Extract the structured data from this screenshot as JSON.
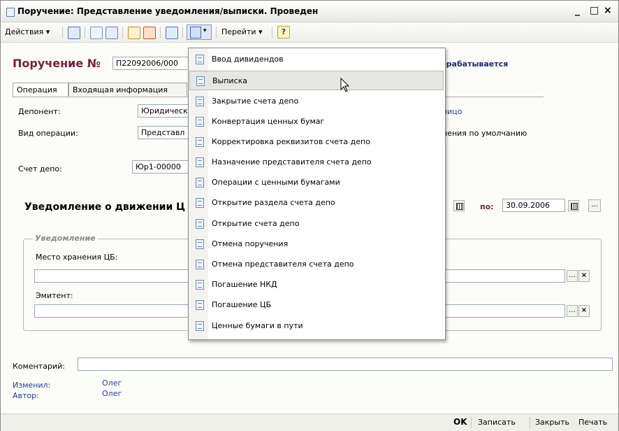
{
  "window": {
    "title": "Поручение: Представление уведомления/выписки. Проведен",
    "minimize": "_",
    "maximize": "□",
    "close": "×"
  },
  "toolbar": {
    "actions_label": "Действия ▾",
    "goto_label": "Перейти ▾",
    "help_label": "?"
  },
  "header": {
    "title": "Поручение №",
    "number": "П22092006/000",
    "status": "брабатывается"
  },
  "tabs": [
    {
      "label": "Операция"
    },
    {
      "label": "Входящая информация"
    }
  ],
  "form": {
    "deponent_label": "Депонент:",
    "deponent_value": "Юридическ",
    "optype_label": "Вид операции:",
    "optype_value": "Представл",
    "account_label": "Счет депо:",
    "account_value": "Юр1-00000",
    "right_link": "лицо",
    "right_text": "нения по умолчанию",
    "notice_title": "Уведомление о движении Ц",
    "to_label": "по:",
    "to_date": "30.09.2006",
    "group_label": "Уведомление",
    "storage_label": "Место хранения ЦБ:",
    "issuer_label": "Эмитент:",
    "comment_label": "Коментарий:",
    "changed_label": "Изменил:",
    "changed_value": "Олег",
    "author_label": "Автор:",
    "author_value": "Олег",
    "ellipsis": "...",
    "clear": "×"
  },
  "footer": {
    "ok": "OK",
    "save": "Записать",
    "close": "Закрыть",
    "print": "Печать"
  },
  "menu": {
    "items": [
      {
        "label": "Ввод дивидендов"
      },
      {
        "label": "Выписка"
      },
      {
        "label": "Закрытие счета депо"
      },
      {
        "label": "Конвертация ценных бумаг"
      },
      {
        "label": "Корректировка реквизитов счета депо"
      },
      {
        "label": "Назначение представителя счета депо"
      },
      {
        "label": "Операции с ценными бумагами"
      },
      {
        "label": "Открытие раздела счета депо"
      },
      {
        "label": "Открытие счета депо"
      },
      {
        "label": "Отмена поручения"
      },
      {
        "label": "Отмена представителя счета депо"
      },
      {
        "label": "Погашение НКД"
      },
      {
        "label": "Погашение ЦБ"
      },
      {
        "label": "Ценные бумаги в пути"
      }
    ],
    "highlighted_index": 1
  },
  "colors": {
    "title_accent": "#7a1f3c",
    "link": "#1f3f9f",
    "status": "#1a2a7a"
  }
}
